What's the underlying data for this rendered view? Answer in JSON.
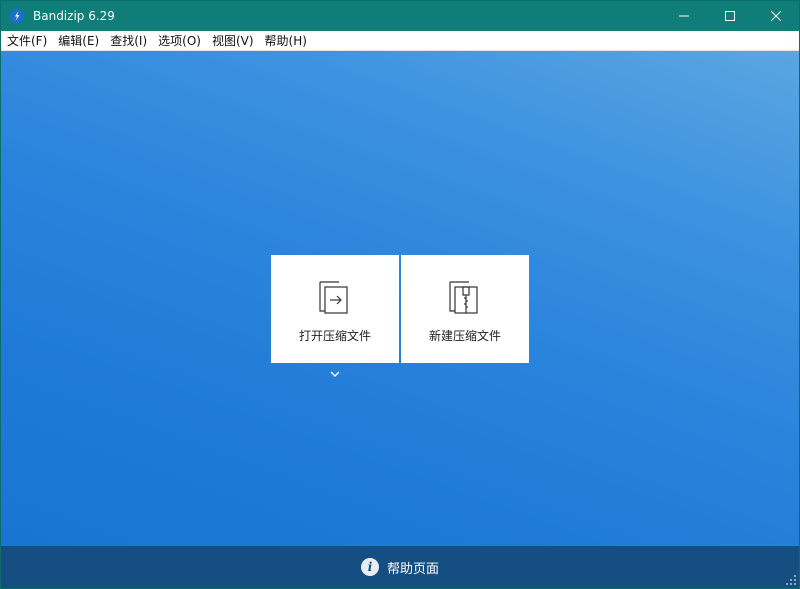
{
  "window": {
    "title": "Bandizip 6.29",
    "titlebar_color": "#0f7e78"
  },
  "menu": [
    {
      "label": "文件(F)"
    },
    {
      "label": "编辑(E)"
    },
    {
      "label": "查找(I)"
    },
    {
      "label": "选项(O)"
    },
    {
      "label": "视图(V)"
    },
    {
      "label": "帮助(H)"
    }
  ],
  "tiles": {
    "open": {
      "label": "打开压缩文件",
      "icon": "open-archive-icon"
    },
    "new": {
      "label": "新建压缩文件",
      "icon": "new-archive-icon"
    }
  },
  "footer": {
    "help_label": "帮助页面",
    "icon": "info-icon",
    "background": "#154f81"
  },
  "colors": {
    "gradient_light": "#5aa6e0",
    "gradient_dark": "#1a74d2"
  }
}
